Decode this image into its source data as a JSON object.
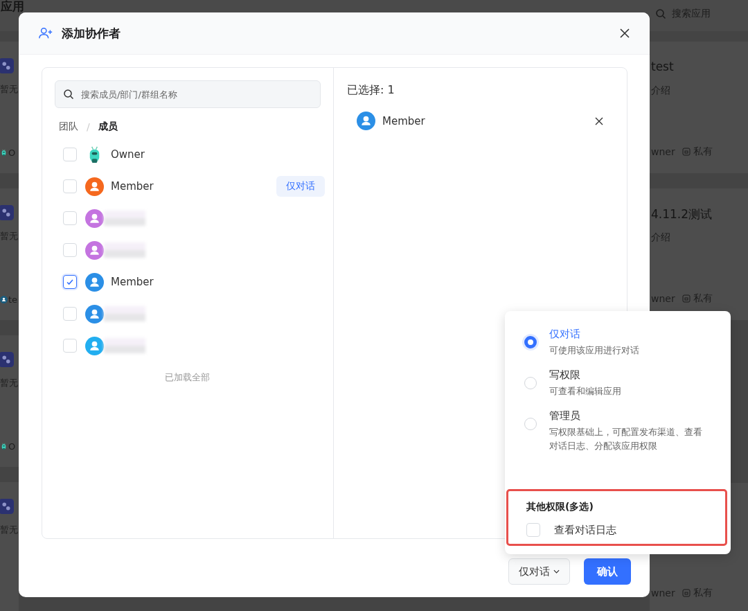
{
  "background": {
    "title": "应用",
    "search": {
      "placeholder": "搜索应用"
    },
    "left_cards": [
      {
        "description": "暂无",
        "owner": "O",
        "kind": "robot"
      },
      {
        "description": "暂无",
        "owner": "te",
        "kind": "person"
      },
      {
        "description": "暂无",
        "owner": "O",
        "kind": "robot"
      },
      {
        "description": "暂无"
      }
    ],
    "right_cards": [
      {
        "title": "test",
        "description": "介绍",
        "owner": "wner",
        "visibility": "私有"
      },
      {
        "title": "4.11.2测试",
        "description": "介绍",
        "owner": "wner",
        "visibility": "私有"
      },
      {
        "owner": "wner",
        "visibility": "私有"
      }
    ]
  },
  "dialog": {
    "title": "添加协作者",
    "search": {
      "placeholder": "搜索成员/部门/群组名称"
    },
    "breadcrumb": [
      {
        "label": "团队",
        "selected": false
      },
      {
        "label": "成员",
        "selected": true
      }
    ],
    "breadcrumb_separator": "/",
    "members": [
      {
        "name": "Owner",
        "kind": "robot",
        "checked": false
      },
      {
        "name": "Member",
        "kind": "person",
        "color": "#f5681e",
        "checked": false,
        "role_badge": "仅对话"
      },
      {
        "kind": "person",
        "color": "#c474e0",
        "checked": false
      },
      {
        "kind": "person",
        "color": "#c474e0",
        "checked": false
      },
      {
        "name": "Member",
        "kind": "person",
        "color": "#2b8fe6",
        "checked": true
      },
      {
        "kind": "person",
        "color": "#2b8fe6",
        "checked": false
      },
      {
        "kind": "person",
        "color": "#22aef0",
        "checked": false
      }
    ],
    "loaded_note": "已加载全部",
    "selected_label": "已选择: 1",
    "selected_members": [
      {
        "name": "Member",
        "color": "#2b8fe6"
      }
    ],
    "role_button": "仅对话",
    "confirm_button": "确认"
  },
  "role_menu": {
    "options": [
      {
        "label": "仅对话",
        "description": "可使用该应用进行对话",
        "selected": true
      },
      {
        "label": "写权限",
        "description": "可查看和编辑应用",
        "selected": false
      },
      {
        "label": "管理员",
        "description": "写权限基础上，可配置发布渠道、查看对话日志、分配该应用权限",
        "selected": false
      }
    ],
    "other_title": "其他权限(多选)",
    "other_options": [
      {
        "label": "查看对话日志",
        "checked": false
      }
    ],
    "highlighted": true
  }
}
